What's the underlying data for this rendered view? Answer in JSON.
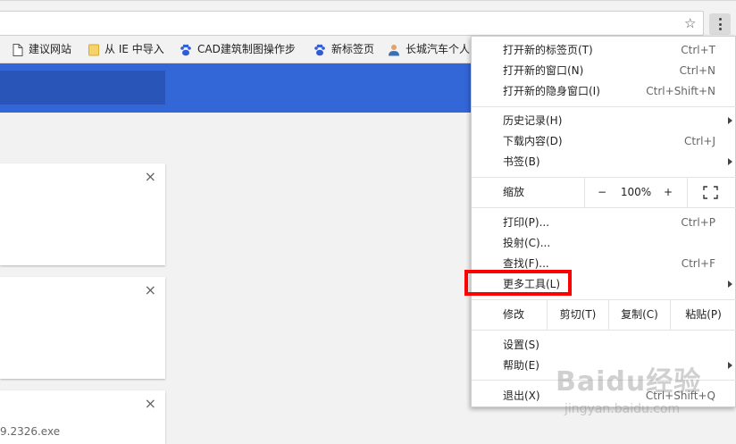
{
  "toolbar": {
    "star": "☆"
  },
  "bookmarks": [
    {
      "label": "建议网站",
      "icon": "page-icon"
    },
    {
      "label": "从 IE 中导入",
      "icon": "folder-icon"
    },
    {
      "label": "CAD建筑制图操作步",
      "icon": "baidu-paw-icon"
    },
    {
      "label": "新标签页",
      "icon": "baidu-paw-icon"
    },
    {
      "label": "长城汽车个人",
      "icon": "person-icon"
    }
  ],
  "page": {
    "close_glyph": "×",
    "download_filename": "9.2326.exe"
  },
  "menu": {
    "items": [
      {
        "label": "打开新的标签页(T)",
        "shortcut": "Ctrl+T"
      },
      {
        "label": "打开新的窗口(N)",
        "shortcut": "Ctrl+N"
      },
      {
        "label": "打开新的隐身窗口(I)",
        "shortcut": "Ctrl+Shift+N"
      },
      {
        "label": "历史记录(H)",
        "shortcut": ""
      },
      {
        "label": "下载内容(D)",
        "shortcut": "Ctrl+J"
      },
      {
        "label": "书签(B)",
        "shortcut": ""
      },
      {
        "label": "打印(P)...",
        "shortcut": "Ctrl+P"
      },
      {
        "label": "投射(C)...",
        "shortcut": ""
      },
      {
        "label": "查找(F)...",
        "shortcut": "Ctrl+F"
      },
      {
        "label": "更多工具(L)",
        "shortcut": ""
      },
      {
        "label": "设置(S)",
        "shortcut": ""
      },
      {
        "label": "帮助(E)",
        "shortcut": ""
      },
      {
        "label": "退出(X)",
        "shortcut": "Ctrl+Shift+Q"
      }
    ],
    "zoom": {
      "label": "缩放",
      "minus": "−",
      "value": "100%",
      "plus": "+"
    },
    "edit": {
      "label": "修改",
      "cut": "剪切(T)",
      "copy": "复制(C)",
      "paste": "粘贴(P)"
    }
  },
  "watermark": {
    "logo": "Baidu经验",
    "url": "jingyan.baidu.com"
  }
}
